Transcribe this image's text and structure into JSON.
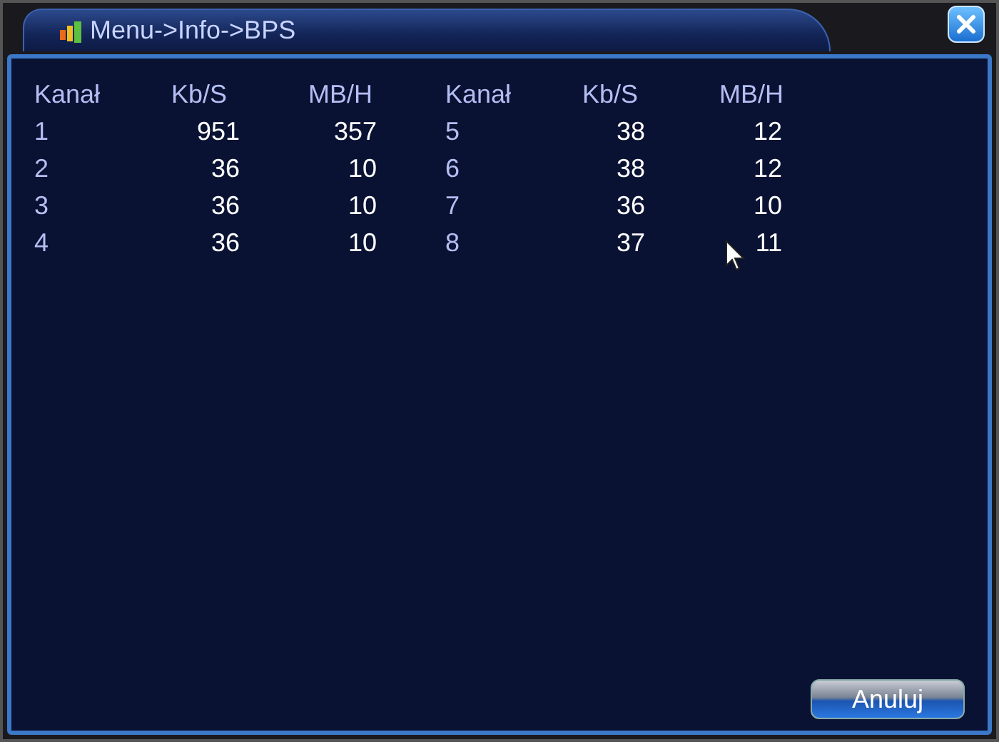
{
  "window": {
    "title": "Menu->Info->BPS"
  },
  "table": {
    "columns": [
      "Kanał",
      "Kb/S",
      "MB/H",
      "Kanał",
      "Kb/S",
      "MB/H"
    ],
    "rows": [
      [
        "1",
        "951",
        "357",
        "5",
        "38",
        "12"
      ],
      [
        "2",
        "36",
        "10",
        "6",
        "38",
        "12"
      ],
      [
        "3",
        "36",
        "10",
        "7",
        "36",
        "10"
      ],
      [
        "4",
        "36",
        "10",
        "8",
        "37",
        "11"
      ]
    ]
  },
  "buttons": [
    "Anuluj"
  ]
}
